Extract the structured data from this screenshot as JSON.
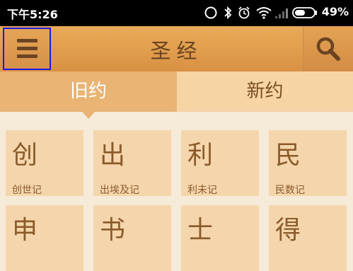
{
  "status_bar": {
    "time": "下午5:26",
    "battery": "49%",
    "icons": [
      "sync-icon",
      "bluetooth-icon",
      "alarm-icon",
      "wifi-icon",
      "signal-icon",
      "battery-icon"
    ]
  },
  "header": {
    "title": "圣经",
    "menu_icon": "hamburger-menu-icon",
    "search_icon": "search-icon",
    "colors": {
      "bar": "#e2a04f",
      "text": "#6a4322",
      "highlight_border": "#1b18e6"
    }
  },
  "tabs": [
    {
      "label": "旧约",
      "active": true
    },
    {
      "label": "新约",
      "active": false
    }
  ],
  "books": [
    {
      "initial": "创",
      "name": "创世记"
    },
    {
      "initial": "出",
      "name": "出埃及记"
    },
    {
      "initial": "利",
      "name": "利未记"
    },
    {
      "initial": "民",
      "name": "民数记"
    },
    {
      "initial": "申",
      "name": ""
    },
    {
      "initial": "书",
      "name": ""
    },
    {
      "initial": "士",
      "name": ""
    },
    {
      "initial": "得",
      "name": ""
    }
  ]
}
